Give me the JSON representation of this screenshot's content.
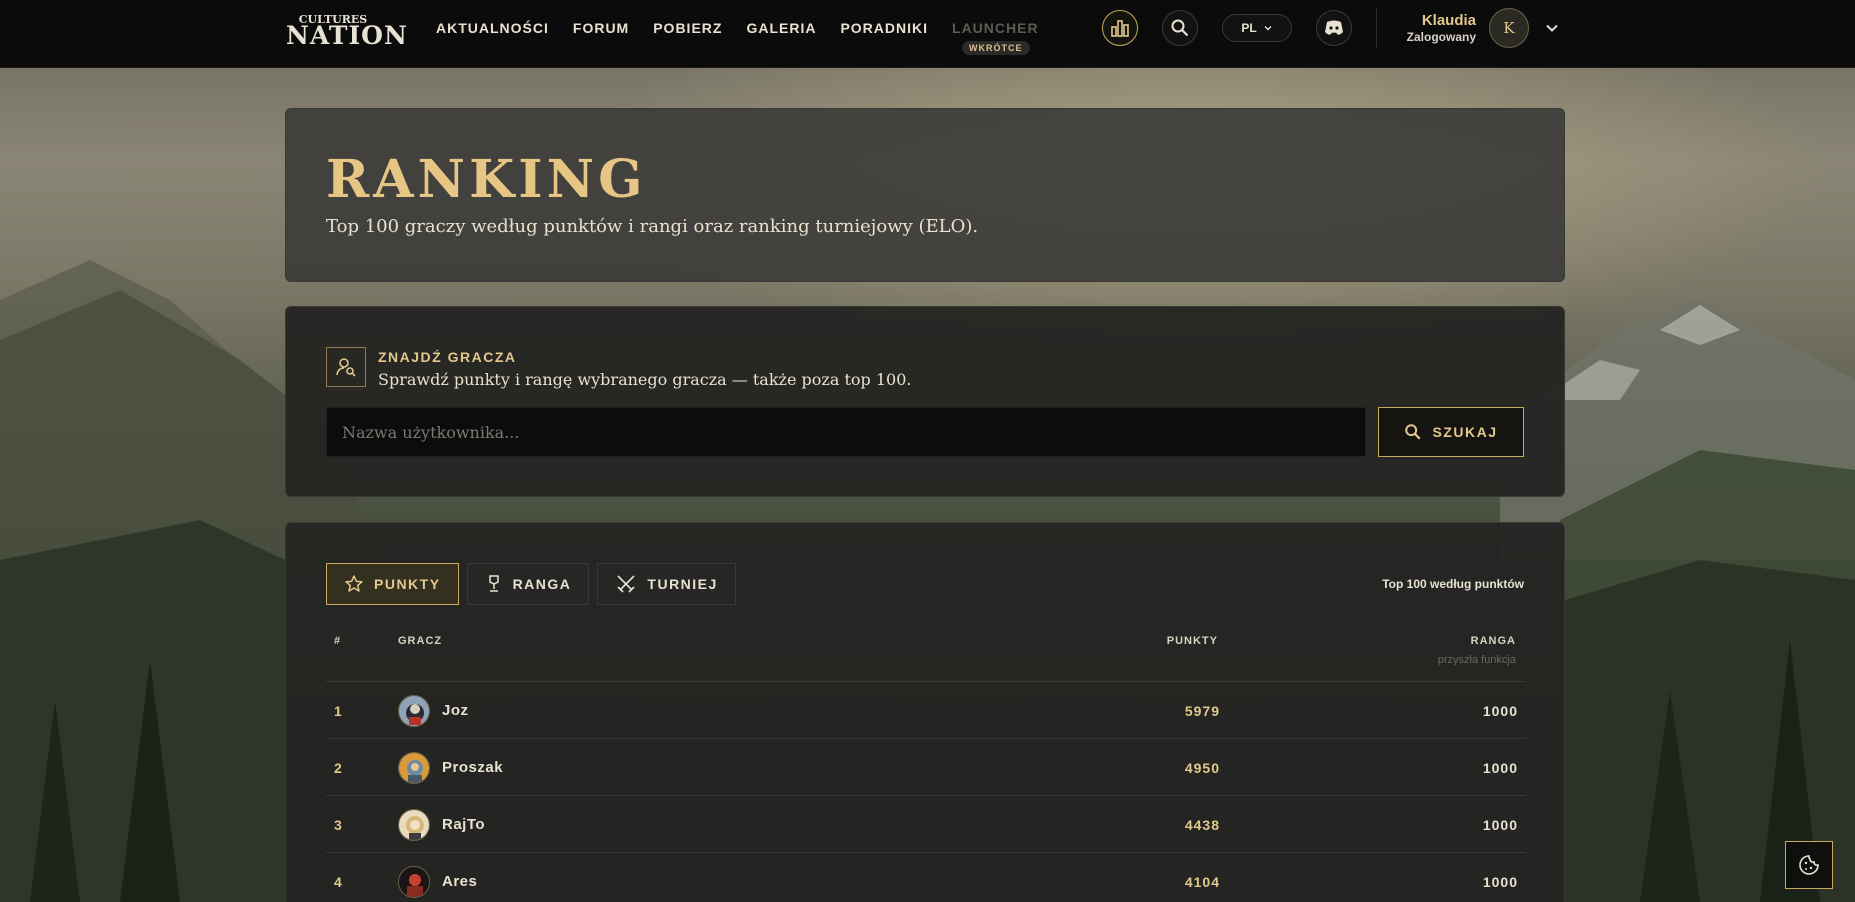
{
  "brand": {
    "logo_top": "CULTURES",
    "logo_bottom": "NATION"
  },
  "nav": {
    "items": [
      {
        "label": "AKTUALNOŚCI"
      },
      {
        "label": "FORUM"
      },
      {
        "label": "POBIERZ"
      },
      {
        "label": "GALERIA"
      },
      {
        "label": "PORADNIKI"
      },
      {
        "label": "LAUNCHER",
        "badge": "WKRÓTCE"
      }
    ],
    "language": "PL"
  },
  "user": {
    "name": "Klaudia",
    "status": "Zalogowany",
    "initial": "K"
  },
  "hero": {
    "title": "RANKING",
    "subtitle": "Top 100 graczy według punktów i rangi oraz ranking turniejowy (ELO)."
  },
  "find_player": {
    "title": "ZNAJDŹ GRACZA",
    "subtitle": "Sprawdź punkty i rangę wybranego gracza — także poza top 100.",
    "placeholder": "Nazwa użytkownika...",
    "button": "SZUKAJ"
  },
  "ranking": {
    "tabs": [
      {
        "label": "PUNKTY",
        "active": true
      },
      {
        "label": "RANGA",
        "active": false
      },
      {
        "label": "TURNIEJ",
        "active": false
      }
    ],
    "note": "Top 100 według punktów",
    "columns": {
      "rank": "#",
      "player": "GRACZ",
      "points": "PUNKTY",
      "grade": "RANGA",
      "grade_sub": "przyszła funkcja"
    },
    "rows": [
      {
        "pos": "1",
        "name": "Joz",
        "points": "5979",
        "grade": "1000"
      },
      {
        "pos": "2",
        "name": "Proszak",
        "points": "4950",
        "grade": "1000"
      },
      {
        "pos": "3",
        "name": "RajTo",
        "points": "4438",
        "grade": "1000"
      },
      {
        "pos": "4",
        "name": "Ares",
        "points": "4104",
        "grade": "1000"
      }
    ]
  },
  "colors": {
    "accent": "#e2c88c",
    "border_gold": "#c9a860",
    "bar": "#0b0b0b"
  }
}
